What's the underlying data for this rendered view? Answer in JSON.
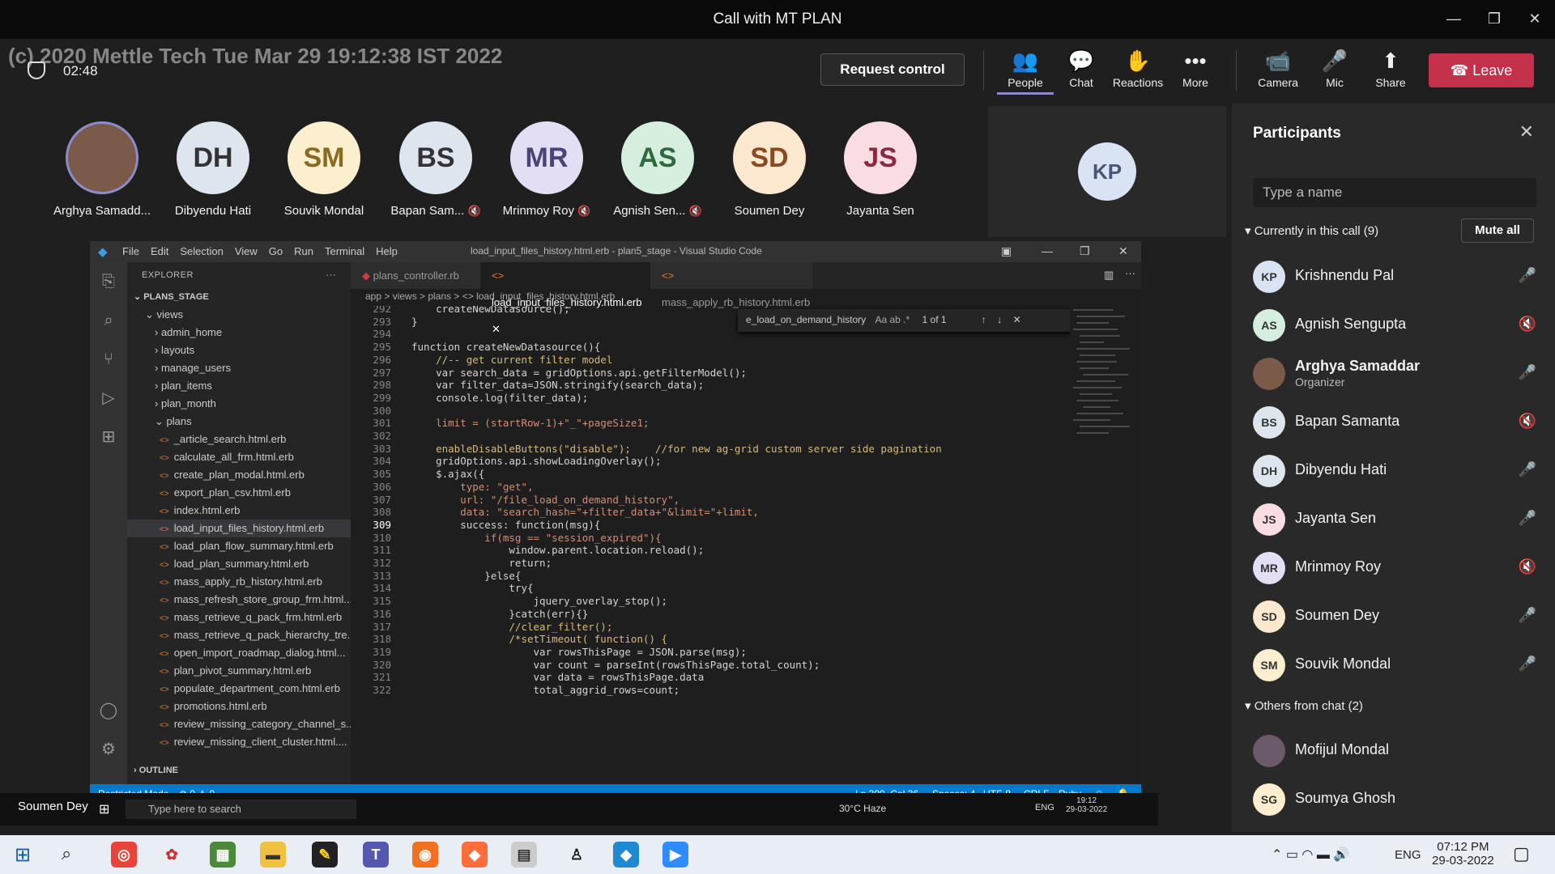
{
  "window": {
    "title": "Call with MT PLAN"
  },
  "watermark": "(c) 2020 Mettle Tech Tue Mar 29 19:12:38 IST 2022",
  "timer": "02:48",
  "meeting": {
    "request_control": "Request control",
    "controls": [
      {
        "label": "People",
        "icon": "people-icon"
      },
      {
        "label": "Chat",
        "icon": "chat-icon"
      },
      {
        "label": "Reactions",
        "icon": "reactions-icon"
      },
      {
        "label": "More",
        "icon": "more-icon"
      },
      {
        "label": "Camera",
        "icon": "camera-off-icon"
      },
      {
        "label": "Mic",
        "icon": "mic-icon"
      },
      {
        "label": "Share",
        "icon": "share-icon"
      }
    ],
    "leave": "Leave"
  },
  "tiles": [
    {
      "name": "Arghya Samadd...",
      "initials": ""
    },
    {
      "name": "Dibyendu Hati",
      "initials": "DH"
    },
    {
      "name": "Souvik Mondal",
      "initials": "SM"
    },
    {
      "name": "Bapan Sam...",
      "initials": "BS"
    },
    {
      "name": "Mrinmoy Roy",
      "initials": "MR"
    },
    {
      "name": "Agnish Sen...",
      "initials": "AS"
    },
    {
      "name": "Soumen Dey",
      "initials": "SD"
    },
    {
      "name": "Jayanta Sen",
      "initials": "JS"
    }
  ],
  "spotlight": {
    "initials": "KP"
  },
  "participants": {
    "title": "Participants",
    "search_placeholder": "Type a name",
    "in_call": "Currently in this call (9)",
    "mute_all": "Mute all",
    "others": "Others from chat (2)",
    "list": [
      {
        "initials": "KP",
        "name": "Krishnendu Pal",
        "color": "#d9e3f3"
      },
      {
        "initials": "AS",
        "name": "Agnish Sengupta",
        "color": "#d5eedd"
      },
      {
        "initials": "",
        "name": "Arghya Samaddar",
        "role": "Organizer",
        "color": "#7b5a4a"
      },
      {
        "initials": "BS",
        "name": "Bapan Samanta",
        "color": "#dde6ee"
      },
      {
        "initials": "DH",
        "name": "Dibyendu Hati",
        "color": "#dde6ee"
      },
      {
        "initials": "JS",
        "name": "Jayanta Sen",
        "color": "#f9dde3"
      },
      {
        "initials": "MR",
        "name": "Mrinmoy Roy",
        "color": "#e3def3"
      },
      {
        "initials": "SD",
        "name": "Soumen Dey",
        "color": "#fbe8cf"
      },
      {
        "initials": "SM",
        "name": "Souvik Mondal",
        "color": "#fbefcf"
      }
    ],
    "others_list": [
      {
        "initials": "",
        "name": "Mofijul Mondal",
        "color": "#6b5a6a"
      },
      {
        "initials": "SG",
        "name": "Soumya Ghosh",
        "color": "#fbefcf"
      }
    ]
  },
  "vscode": {
    "menu": [
      "File",
      "Edit",
      "Selection",
      "View",
      "Go",
      "Run",
      "Terminal",
      "Help"
    ],
    "title": "load_input_files_history.html.erb - plan5_stage - Visual Studio Code",
    "explorer": "EXPLORER",
    "project": "PLANS_STAGE",
    "folders": [
      "views",
      "admin_home",
      "layouts",
      "manage_users",
      "plan_items",
      "plan_month",
      "plans"
    ],
    "files": [
      "_article_search.html.erb",
      "calculate_all_frm.html.erb",
      "create_plan_modal.html.erb",
      "export_plan_csv.html.erb",
      "index.html.erb",
      "load_input_files_history.html.erb",
      "load_plan_flow_summary.html.erb",
      "load_plan_summary.html.erb",
      "mass_apply_rb_history.html.erb",
      "mass_refresh_store_group_frm.html...",
      "mass_retrieve_q_pack_frm.html.erb",
      "mass_retrieve_q_pack_hierarchy_tre...",
      "open_import_roadmap_dialog.html...",
      "plan_pivot_summary.html.erb",
      "populate_department_com.html.erb",
      "promotions.html.erb",
      "review_missing_category_channel_s...",
      "review_missing_client_cluster.html...."
    ],
    "outline": "OUTLINE",
    "tabs": [
      "plans_controller.rb",
      "load_input_files_history.html.erb",
      "mass_apply_rb_history.html.erb"
    ],
    "breadcrumb": "app > views > plans > <> load_input_files_history.html.erb",
    "find": {
      "query": "e_load_on_demand_history",
      "result": "1 of 1"
    },
    "lines": [
      {
        "n": "292",
        "c": "    createNewDatasource();"
      },
      {
        "n": "293",
        "c": "}"
      },
      {
        "n": "294",
        "c": ""
      },
      {
        "n": "295",
        "c": "function createNewDatasource(){"
      },
      {
        "n": "296",
        "c": "    //-- get current filter model"
      },
      {
        "n": "297",
        "c": "    var search_data = gridOptions.api.getFilterModel();"
      },
      {
        "n": "298",
        "c": "    var filter_data=JSON.stringify(search_data);"
      },
      {
        "n": "299",
        "c": "    console.log(filter_data);"
      },
      {
        "n": "300",
        "c": ""
      },
      {
        "n": "301",
        "c": "    limit = (startRow-1)+\"_\"+pageSize1;"
      },
      {
        "n": "302",
        "c": ""
      },
      {
        "n": "303",
        "c": "    enableDisableButtons(\"disable\");    //for new ag-grid custom server side pagination"
      },
      {
        "n": "304",
        "c": "    gridOptions.api.showLoadingOverlay();"
      },
      {
        "n": "305",
        "c": "    $.ajax({"
      },
      {
        "n": "306",
        "c": "        type: \"get\","
      },
      {
        "n": "307",
        "c": "        url: \"/file_load_on_demand_history\","
      },
      {
        "n": "308",
        "c": "        data: \"search_hash=\"+filter_data+\"&limit=\"+limit,"
      },
      {
        "n": "309",
        "c": "        success: function(msg){"
      },
      {
        "n": "310",
        "c": "            if(msg == \"session_expired\"){"
      },
      {
        "n": "311",
        "c": "                window.parent.location.reload();"
      },
      {
        "n": "312",
        "c": "                return;"
      },
      {
        "n": "313",
        "c": "            }else{"
      },
      {
        "n": "314",
        "c": "                try{"
      },
      {
        "n": "315",
        "c": "                    jquery_overlay_stop();"
      },
      {
        "n": "316",
        "c": "                }catch(err){}"
      },
      {
        "n": "317",
        "c": "                //clear_filter();"
      },
      {
        "n": "318",
        "c": "                /*setTimeout( function() {"
      },
      {
        "n": "319",
        "c": "                    var rowsThisPage = JSON.parse(msg);"
      },
      {
        "n": "320",
        "c": "                    var count = parseInt(rowsThisPage.total_count);"
      },
      {
        "n": "321",
        "c": "                    var data = rowsThisPage.data"
      },
      {
        "n": "322",
        "c": "                    total_aggrid_rows=count;"
      }
    ],
    "status": {
      "restricted": "Restricted Mode",
      "problems": "⊗ 0 ⚠ 0",
      "pos": "Ln 309, Col 36",
      "spaces": "Spaces: 4",
      "enc": "UTF-8",
      "eol": "CRLF",
      "lang": "Ruby"
    }
  },
  "inner_taskbar": {
    "search": "Type here to search",
    "weather": "30°C  Haze",
    "lang": "ENG",
    "time": "19:12",
    "date": "29-03-2022"
  },
  "speaker_label": "Soumen Dey",
  "taskbar": {
    "time": "07:12 PM",
    "date": "29-03-2022",
    "lang": "ENG"
  }
}
